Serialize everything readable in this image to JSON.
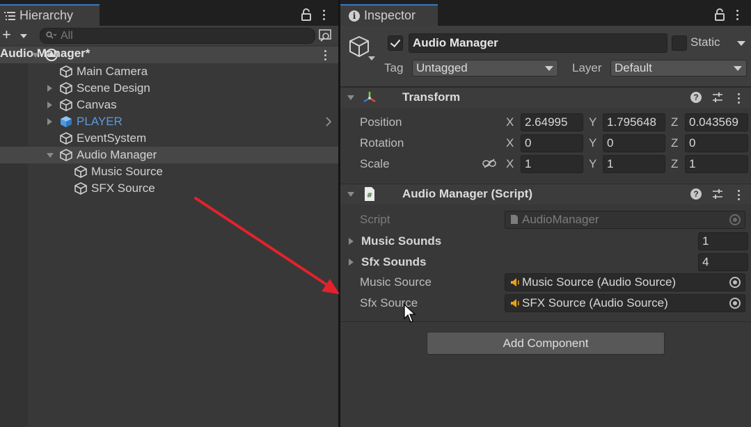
{
  "hierarchy": {
    "tab_label": "Hierarchy",
    "search_placeholder": "All",
    "scene_name": "Audio Manager*",
    "items": [
      {
        "label": "Main Camera"
      },
      {
        "label": "Scene Design"
      },
      {
        "label": "Canvas"
      },
      {
        "label": "PLAYER"
      },
      {
        "label": "EventSystem"
      },
      {
        "label": "Audio Manager"
      },
      {
        "label": "Music Source"
      },
      {
        "label": "SFX Source"
      }
    ]
  },
  "inspector": {
    "tab_label": "Inspector",
    "object_name": "Audio Manager",
    "active": true,
    "static_label": "Static",
    "tag_label": "Tag",
    "tag_value": "Untagged",
    "layer_label": "Layer",
    "layer_value": "Default",
    "transform": {
      "title": "Transform",
      "position_label": "Position",
      "rotation_label": "Rotation",
      "scale_label": "Scale",
      "axis_x": "X",
      "axis_y": "Y",
      "axis_z": "Z",
      "position": {
        "x": "2.64995",
        "y": "1.795648",
        "z": "0.043569"
      },
      "rotation": {
        "x": "0",
        "y": "0",
        "z": "0"
      },
      "scale": {
        "x": "1",
        "y": "1",
        "z": "1"
      }
    },
    "script_component": {
      "title": "Audio Manager (Script)",
      "script_label": "Script",
      "script_value": "AudioManager",
      "music_sounds_label": "Music Sounds",
      "music_sounds_count": "1",
      "sfx_sounds_label": "Sfx Sounds",
      "sfx_sounds_count": "4",
      "music_source_label": "Music Source",
      "music_source_value": "Music Source (Audio Source)",
      "sfx_source_label": "Sfx Source",
      "sfx_source_value": "SFX Source (Audio Source)"
    },
    "add_component_label": "Add Component"
  },
  "colors": {
    "panel_bg": "#383838",
    "accent_tab": "#3a79bb",
    "player_blue": "#5b9ae0",
    "annotation_arrow": "#e3222b",
    "speaker_yellow": "#e8a21a"
  }
}
